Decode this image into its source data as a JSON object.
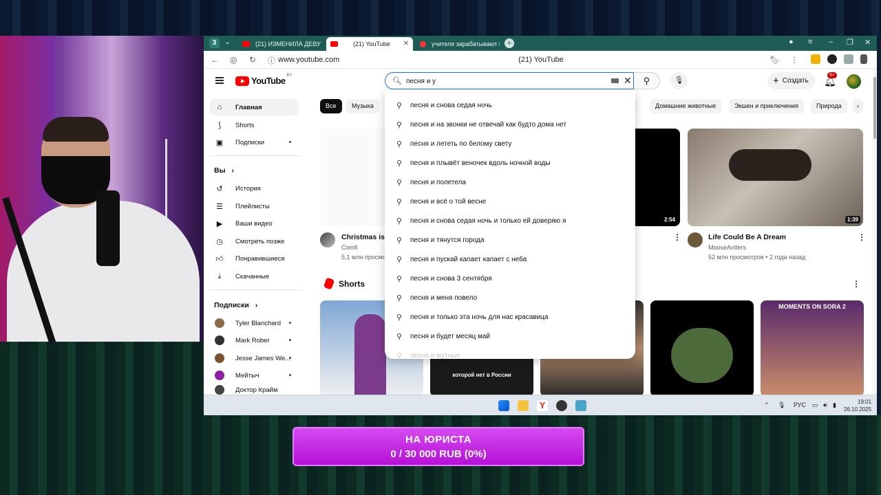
{
  "browser": {
    "tab_count": "3",
    "tabs": [
      {
        "label": "(21) ИЗМЕНИЛА ДЕВУШ"
      },
      {
        "label": "(21) YouTube"
      },
      {
        "label": "учителя зарабатывают м"
      }
    ],
    "url": "www.youtube.com",
    "page_title": "(21) YouTube"
  },
  "youtube": {
    "logo_text": "YouTube",
    "logo_country": "BY",
    "search_value": "песня и у",
    "create_label": "Создать",
    "notifications": "9+"
  },
  "sidebar": {
    "main": [
      {
        "label": "Главная",
        "icon": "home-icon"
      },
      {
        "label": "Shorts",
        "icon": "shorts-icon"
      },
      {
        "label": "Подписки",
        "icon": "subscriptions-icon"
      }
    ],
    "you_header": "Вы",
    "you": [
      {
        "label": "История",
        "icon": "history-icon"
      },
      {
        "label": "Плейлисты",
        "icon": "playlists-icon"
      },
      {
        "label": "Ваши видео",
        "icon": "your-videos-icon"
      },
      {
        "label": "Смотреть позже",
        "icon": "watch-later-icon"
      },
      {
        "label": "Понравившиеся",
        "icon": "liked-icon"
      },
      {
        "label": "Скачанные",
        "icon": "download-icon"
      }
    ],
    "subs_header": "Подписки",
    "subs": [
      {
        "label": "Tyler Blanchard",
        "color": "#8a6a4a"
      },
      {
        "label": "Mark Rober",
        "color": "#333333"
      },
      {
        "label": "Jesse James We...",
        "color": "#7a5230"
      },
      {
        "label": "Мейтыч",
        "color": "#8b1fa0"
      },
      {
        "label": "Доктор Крайм",
        "color": "#444444"
      }
    ]
  },
  "chips": [
    "Все",
    "Музыка",
    "п",
    "Домашние животные",
    "Экшен и приключения",
    "Природа"
  ],
  "suggestions": [
    "песня и снова седая ночь",
    "песня и на звонки не отвечай как будто дома нет",
    "песня и лететь по белому свету",
    "песня и плывёт веночек вдоль ночной воды",
    "песня и полетела",
    "песня и всё о той весне",
    "песня и снова седая ночь и только ей доверяю я",
    "песня и тянутся города",
    "песня и пускай капает капает с неба",
    "песня и снова 3 сентября",
    "песня и меня повело",
    "песня и только эта ночь для нас красавица",
    "песня и будет месяц май",
    "песня и мутные"
  ],
  "videos": {
    "left_title": "Christmas is c",
    "left_channel": "Comfi",
    "left_meta": "5,1 млн просмотр",
    "mid_duration": "2:54",
    "right_title": "Life Could Be A Dream",
    "right_channel": "MooseAntlers",
    "right_meta": "52 млн просмотров • 2 года назад",
    "right_duration": "1:39"
  },
  "shorts": {
    "title": "Shorts",
    "items": [
      {
        "caption": ""
      },
      {
        "caption": "которой нет в России"
      },
      {
        "caption": ""
      },
      {
        "caption": ""
      },
      {
        "caption": "MOMENTS ON SORA 2"
      }
    ]
  },
  "taskbar": {
    "lang": "РУС",
    "time": "19:01",
    "date": "26.10.2025"
  },
  "donation": {
    "title": "НА ЮРИСТА",
    "progress_text": "0 / 30 000 RUB (0%)",
    "progress_fraction": 0
  }
}
